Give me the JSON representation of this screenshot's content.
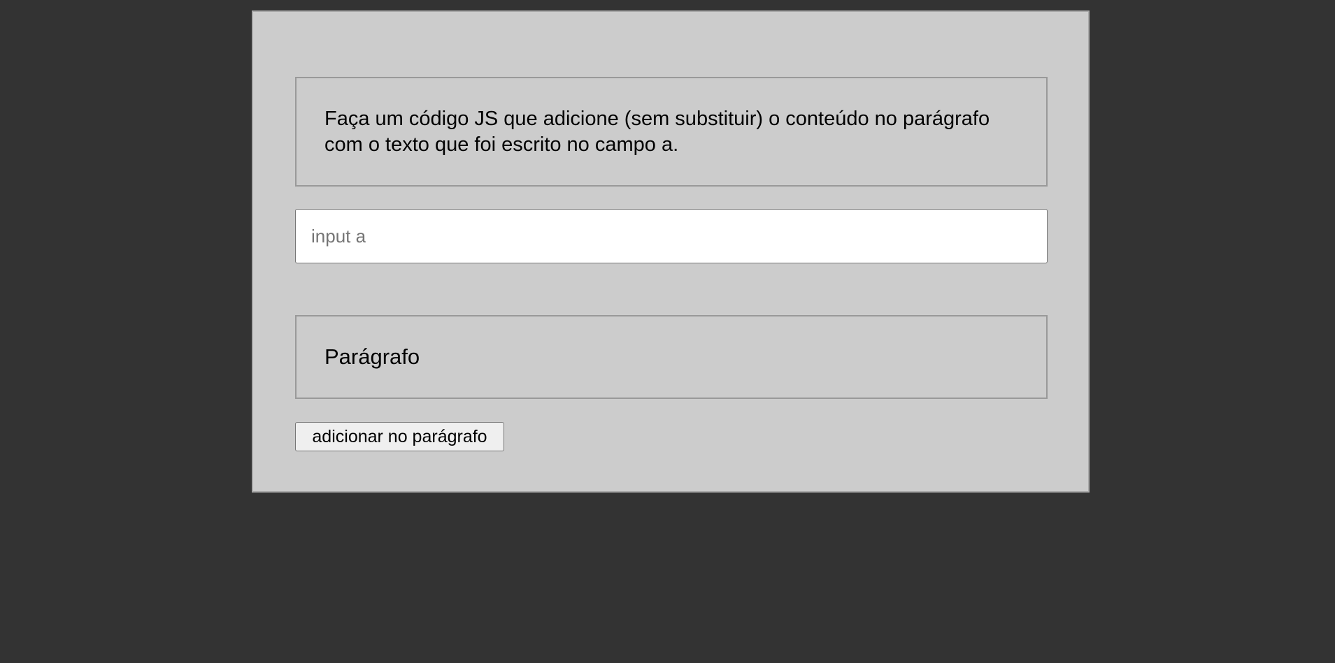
{
  "panel": {
    "instruction": "Faça um código JS que adicione (sem substituir) o conteúdo no parágrafo com o texto que foi escrito no campo a.",
    "input_a": {
      "value": "",
      "placeholder": "input a"
    },
    "paragraph": "Parágrafo",
    "add_button_label": "adicionar no parágrafo"
  },
  "colors": {
    "page_background": "#333333",
    "panel_background": "#cccccc",
    "box_border": "#999999",
    "input_background": "#ffffff",
    "button_background": "#efefef"
  }
}
